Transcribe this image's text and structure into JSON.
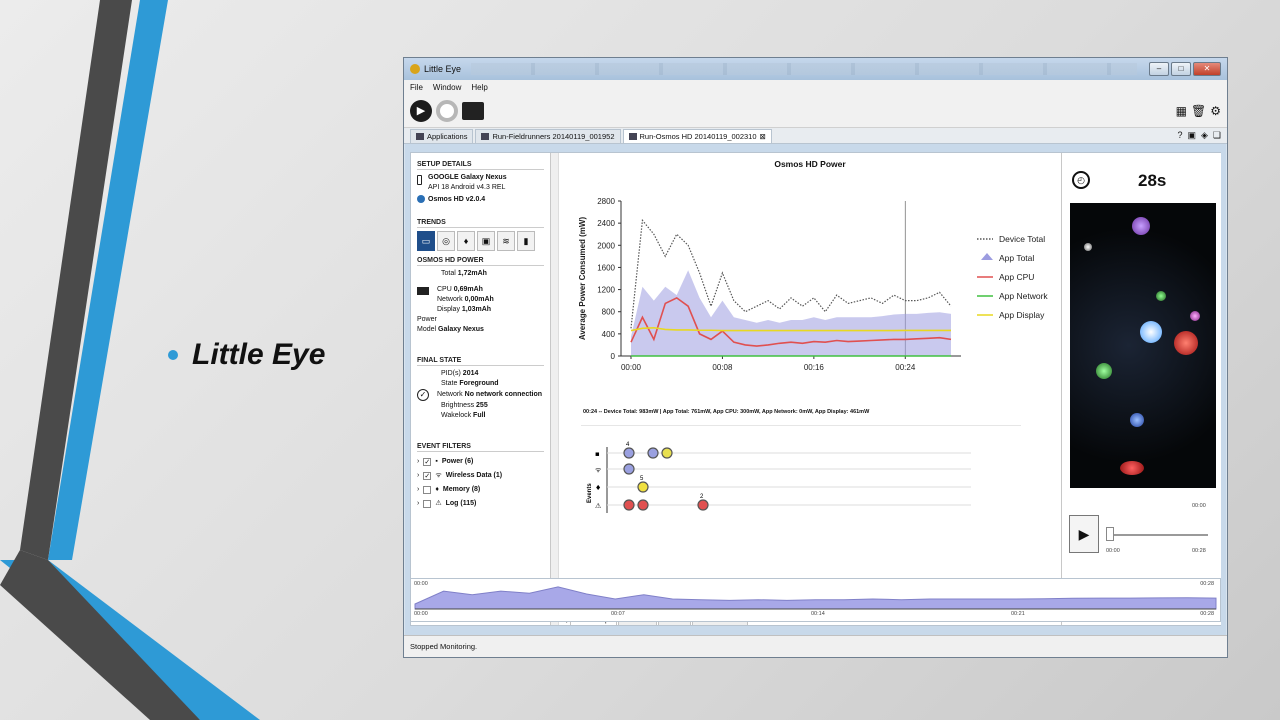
{
  "slide": {
    "bullet_text": "Little Eye",
    "accent_color": "#2e9ad6"
  },
  "window": {
    "title": "Little Eye",
    "menu": [
      "File",
      "Window",
      "Help"
    ],
    "tabs": [
      {
        "label": "Applications"
      },
      {
        "label": "Run-Fieldrunners 20140119_001952"
      },
      {
        "label": "Run-Osmos HD 20140119_002310"
      }
    ],
    "status": "Stopped Monitoring."
  },
  "setup": {
    "header": "SETUP DETAILS",
    "device": "GOOGLE Galaxy Nexus",
    "api": "API 18 Android v4.3 REL",
    "app": "Osmos HD v2.0.4"
  },
  "trends": {
    "header": "TRENDS",
    "icons": [
      "battery-icon",
      "wifi-icon",
      "drop-icon",
      "chip-icon",
      "memory-icon",
      "sd-icon"
    ]
  },
  "power": {
    "header": "OSMOS HD POWER",
    "total_label": "Total",
    "total_value": "1,72mAh",
    "cpu_label": "CPU",
    "cpu_value": "0,69mAh",
    "network_label": "Network",
    "network_value": "0,00mAh",
    "display_label": "Display",
    "display_value": "1,03mAh",
    "power_label": "Power",
    "model_label": "Model",
    "model_value": "Galaxy Nexus"
  },
  "final_state": {
    "header": "FINAL STATE",
    "pid_label": "PID(s)",
    "pid_value": "2014",
    "state_label": "State",
    "state_value": "Foreground",
    "network_label": "Network",
    "network_value": "No network connection",
    "brightness_label": "Brightness",
    "brightness_value": "255",
    "wakelock_label": "Wakelock",
    "wakelock_value": "Full"
  },
  "event_filters": {
    "header": "EVENT FILTERS",
    "items": [
      {
        "label": "Power (6)",
        "checked": true
      },
      {
        "label": "Wireless Data (1)",
        "checked": true
      },
      {
        "label": "Memory (8)",
        "checked": false
      },
      {
        "label": "Log (115)",
        "checked": false
      }
    ]
  },
  "event_graph": {
    "summary": "00:24 -- Device Total: 983mW | App Total: 761mW, App CPU: 300mW, App Network: 0mW, App Display: 461mW",
    "ylabel": "Events",
    "marker_labels": [
      "4",
      "5",
      "2"
    ]
  },
  "subtabs": [
    "Event Graph",
    "Event List",
    "Threads",
    "HTTP Statistics"
  ],
  "video": {
    "timer": "28s",
    "time_top": "00:00",
    "time_start": "00:00",
    "time_end": "00:28"
  },
  "timeline": {
    "top_left": "00:00",
    "top_right": "00:28",
    "ticks": [
      "00:00",
      "00:07",
      "00:14",
      "00:21",
      "00:28"
    ]
  },
  "chart_data": {
    "type": "line",
    "title": "Osmos HD Power",
    "xlabel": "",
    "ylabel": "Average Power Consumed (mW)",
    "x": [
      "00:00",
      "00:01",
      "00:02",
      "00:03",
      "00:04",
      "00:05",
      "00:06",
      "00:07",
      "00:08",
      "00:09",
      "00:10",
      "00:11",
      "00:12",
      "00:13",
      "00:14",
      "00:15",
      "00:16",
      "00:17",
      "00:18",
      "00:19",
      "00:20",
      "00:21",
      "00:22",
      "00:23",
      "00:24",
      "00:25",
      "00:26",
      "00:27",
      "00:28"
    ],
    "x_ticks": [
      "00:00",
      "00:08",
      "00:16",
      "00:24"
    ],
    "ylim": [
      0,
      2800
    ],
    "y_ticks": [
      0,
      400,
      800,
      1200,
      1600,
      2000,
      2400,
      2800
    ],
    "legend_position": "right",
    "cursor_x": "00:24",
    "series": [
      {
        "name": "Device Total",
        "color": "#555555",
        "style": "dotted",
        "values": [
          500,
          2450,
          2200,
          1800,
          2200,
          2000,
          1500,
          900,
          1500,
          1000,
          800,
          900,
          1000,
          850,
          1050,
          900,
          1050,
          800,
          1100,
          950,
          1000,
          1050,
          950,
          1100,
          1000,
          1000,
          1050,
          1150,
          900
        ]
      },
      {
        "name": "App Total",
        "color": "#9c9ce0",
        "style": "area",
        "values": [
          350,
          1250,
          1000,
          1250,
          1100,
          1550,
          1050,
          700,
          1000,
          700,
          650,
          600,
          650,
          600,
          650,
          650,
          700,
          650,
          700,
          700,
          700,
          700,
          720,
          750,
          761,
          760,
          780,
          790,
          760
        ]
      },
      {
        "name": "App CPU",
        "color": "#e05050",
        "style": "line",
        "values": [
          250,
          700,
          300,
          950,
          1050,
          900,
          400,
          300,
          450,
          250,
          200,
          180,
          200,
          230,
          250,
          230,
          260,
          250,
          280,
          260,
          270,
          280,
          290,
          300,
          300,
          310,
          320,
          330,
          300
        ]
      },
      {
        "name": "App Network",
        "color": "#40c040",
        "style": "line",
        "values": [
          0,
          0,
          0,
          0,
          0,
          0,
          0,
          0,
          0,
          0,
          0,
          0,
          0,
          0,
          0,
          0,
          0,
          0,
          0,
          0,
          0,
          0,
          0,
          0,
          0,
          0,
          0,
          0,
          0
        ]
      },
      {
        "name": "App Display",
        "color": "#e8d820",
        "style": "line",
        "values": [
          460,
          500,
          510,
          480,
          470,
          470,
          465,
          465,
          460,
          460,
          460,
          460,
          460,
          460,
          460,
          460,
          460,
          460,
          460,
          460,
          460,
          460,
          460,
          460,
          461,
          461,
          461,
          461,
          461
        ]
      }
    ]
  }
}
